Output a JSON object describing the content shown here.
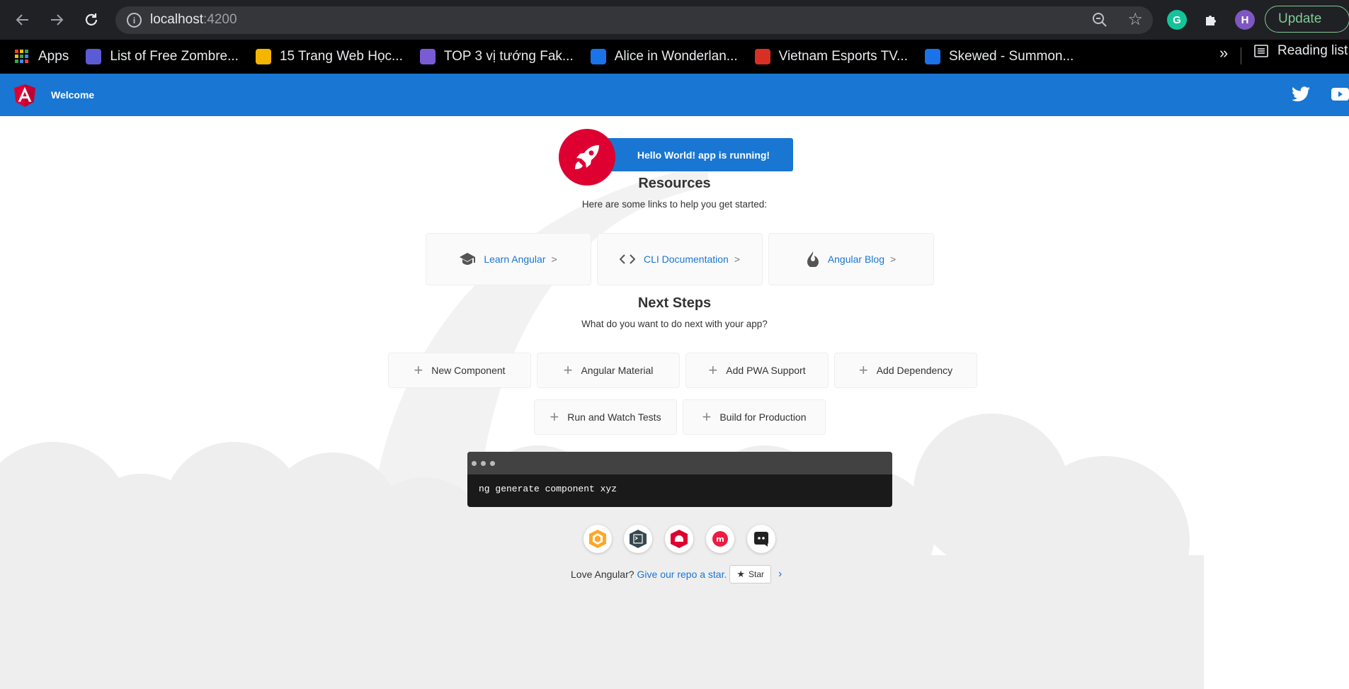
{
  "browser": {
    "url_host": "localhost",
    "url_port": ":4200",
    "update_label": "Update",
    "profile_initial": "H",
    "bookmarks": [
      {
        "label": "Apps",
        "icon": "apps-grid-icon",
        "color": "#4285f4"
      },
      {
        "label": "List of Free Zombre...",
        "icon": "bookmark-favicon",
        "color": "#5b5bd6"
      },
      {
        "label": "15 Trang Web Học...",
        "icon": "bookmark-favicon",
        "color": "#f4b400"
      },
      {
        "label": "TOP 3 vị tướng Fak...",
        "icon": "bookmark-favicon",
        "color": "#7a5bd6"
      },
      {
        "label": "Alice in Wonderlan...",
        "icon": "bookmark-favicon",
        "color": "#1a73e8"
      },
      {
        "label": "Vietnam Esports TV...",
        "icon": "bookmark-favicon",
        "color": "#d93025"
      },
      {
        "label": "Skewed - Summon...",
        "icon": "bookmark-favicon",
        "color": "#1a73e8"
      }
    ],
    "more_bookmarks": "»",
    "reading_list": "Reading list"
  },
  "app": {
    "toolbar_title": "Welcome",
    "accent": "#1976d2",
    "brand_red": "#dd0031",
    "running_message": "Hello World! app is running!",
    "resources": {
      "title": "Resources",
      "subtitle": "Here are some links to help you get started:",
      "cards": [
        {
          "label": "Learn Angular",
          "icon": "graduation-cap-icon"
        },
        {
          "label": "CLI Documentation",
          "icon": "code-brackets-icon"
        },
        {
          "label": "Angular Blog",
          "icon": "flame-icon"
        }
      ]
    },
    "next_steps": {
      "title": "Next Steps",
      "subtitle": "What do you want to do next with your app?",
      "buttons": [
        "New Component",
        "Angular Material",
        "Add PWA Support",
        "Add Dependency",
        "Run and Watch Tests",
        "Build for Production"
      ]
    },
    "terminal_command": "ng generate component xyz",
    "footer": {
      "love_text": "Love Angular?",
      "link_text": "Give our repo a star.",
      "star_label": "Star",
      "chevron": "›"
    }
  }
}
